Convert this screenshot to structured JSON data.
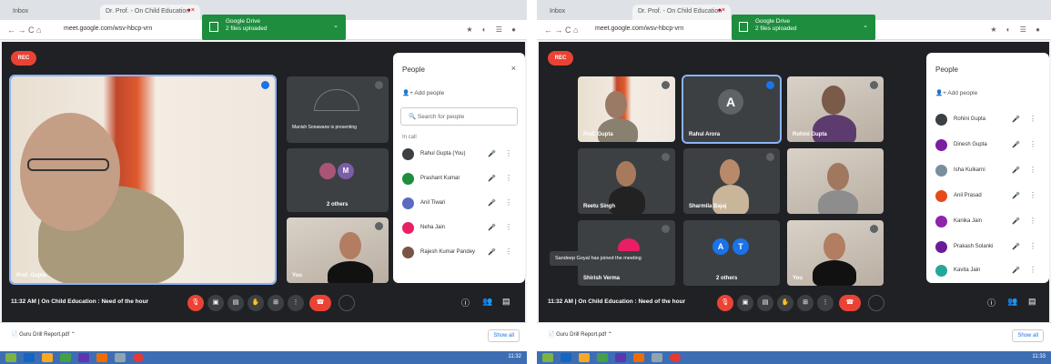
{
  "left": {
    "tabs": [
      "Inbox",
      "Dr. Prof. - On Child Education"
    ],
    "notification": {
      "title": "Google Drive",
      "subtitle": "2 files uploaded"
    },
    "url": "meet.google.com/wsv-hbcp-vrn",
    "rec": "REC",
    "tiles": {
      "main": "Prof. Gupta",
      "screen": "Manish Sonawane is presenting",
      "two": "2 others",
      "cam": "You"
    },
    "panel": {
      "title": "People",
      "close": "×",
      "add": "Add people",
      "search": "Search for people",
      "section": "In call",
      "people": [
        "Rahul Gupta (You)",
        "Prashant Kumar",
        "Anil Tiwari",
        "Neha Jain",
        "Rajesh Kumar Pandey"
      ]
    },
    "meeting": {
      "time": "11:32 AM",
      "title": "On Child Education : Need of the hour"
    },
    "download": {
      "file": "Guru Drill Report.pdf",
      "showall": "Show all"
    },
    "clock": "11:32"
  },
  "right": {
    "tabs": [
      "Inbox",
      "Dr. Prof. - On Child Education"
    ],
    "notification": {
      "title": "Google Drive",
      "subtitle": "2 files uploaded"
    },
    "url": "meet.google.com/wsv-hbcp-vrn",
    "rec": "REC",
    "tiles": {
      "t1": "Prof. Gupta",
      "t2": "Rahul Arora",
      "t2avatar": "A",
      "t3": "Rohini Gupta",
      "t4": "Reetu Singh",
      "t5": "Sharmila Bajaj",
      "t6": "",
      "t7": "Shirish Verma",
      "t8": "2 others",
      "t8a": "A",
      "t8b": "T",
      "t9": "You"
    },
    "toast": "Sandeep Goyal has joined the meeting",
    "panel": {
      "title": "People",
      "add": "Add people",
      "people": [
        "Rohini Gupta",
        "Dinesh Gupta",
        "Isha Kulkarni",
        "Anil Prasad",
        "Kanika Jain",
        "Prakash Solanki",
        "Kavita Jain"
      ]
    },
    "meeting": {
      "time": "11:32 AM",
      "title": "On Child Education : Need of the hour"
    },
    "download": {
      "file": "Guru Drill Report.pdf",
      "showall": "Show all"
    },
    "clock": "11:33"
  },
  "colors": {
    "meet_bg": "#202124",
    "tile": "#3c4043",
    "red": "#ea4335",
    "green": "#1e8e3e"
  }
}
